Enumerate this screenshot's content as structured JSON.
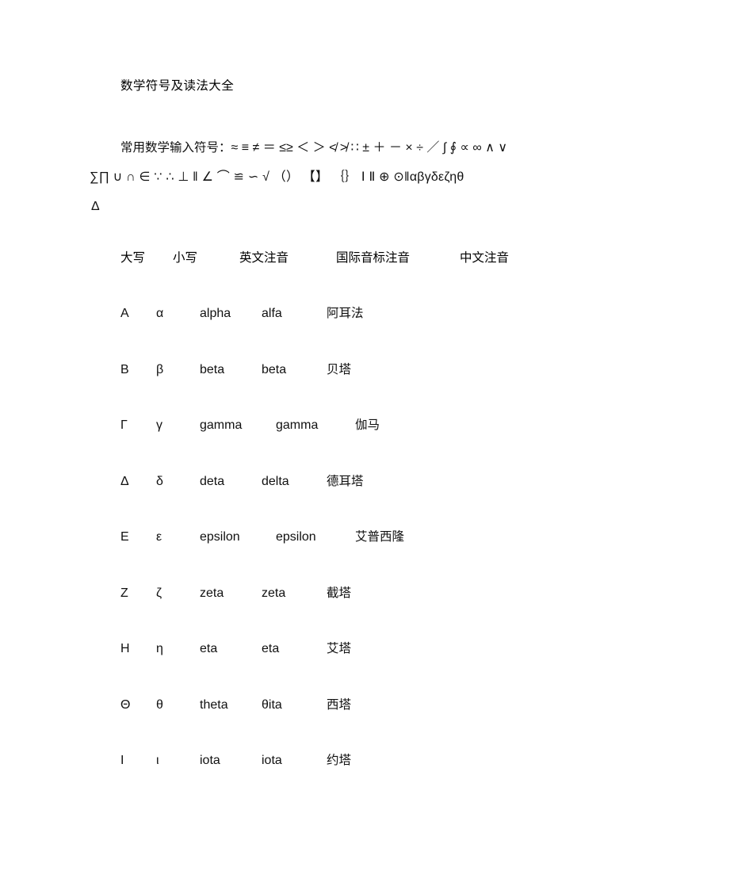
{
  "document": {
    "title": "数学符号及读法大全",
    "background_color": "#ffffff",
    "text_color": "#111111"
  },
  "symbols": {
    "lead_label": "常用数学输入符号：",
    "line1": "≈ ≡ ≠ ＝ ≤≥ ＜ ＞ ≮ ≯ ∷ ± ＋ － × ÷ ／ ∫ ∮ ∝ ∞ ∧ ∨",
    "line2": "∑∏ ∪ ∩ ∈ ∵ ∴ ⊥ ‖ ∠ ⌒ ≌ ∽ √ （） 【】 ｛｝ Ⅰ Ⅱ ⊕ ⊙‖αβγδεζηθ",
    "line3": "Δ"
  },
  "table": {
    "headers": [
      "大写",
      "小写",
      "英文注音",
      "国际音标注音",
      "中文注音"
    ],
    "rows": [
      {
        "upper": "Α",
        "lower": "α",
        "english": "alpha",
        "ipa": "alfa",
        "chinese": "阿耳法"
      },
      {
        "upper": "Β",
        "lower": "β",
        "english": "beta",
        "ipa": "beta",
        "chinese": "贝塔"
      },
      {
        "upper": "Γ",
        "lower": "γ",
        "english": "gamma",
        "ipa": "gamma",
        "chinese": "伽马"
      },
      {
        "upper": "Δ",
        "lower": "δ",
        "english": "deta",
        "ipa": "delta",
        "chinese": "德耳塔"
      },
      {
        "upper": "Ε",
        "lower": "ε",
        "english": "epsilon",
        "ipa": "epsilon",
        "chinese": "艾普西隆"
      },
      {
        "upper": "Ζ",
        "lower": "ζ",
        "english": "zeta",
        "ipa": "zeta",
        "chinese": "截塔"
      },
      {
        "upper": "Η",
        "lower": "η",
        "english": "eta",
        "ipa": "eta",
        "chinese": "艾塔"
      },
      {
        "upper": "Θ",
        "lower": "θ",
        "english": "theta",
        "ipa": "θita",
        "chinese": "西塔"
      },
      {
        "upper": "Ι",
        "lower": "ι",
        "english": "iota",
        "ipa": "iota",
        "chinese": "约塔"
      }
    ]
  }
}
